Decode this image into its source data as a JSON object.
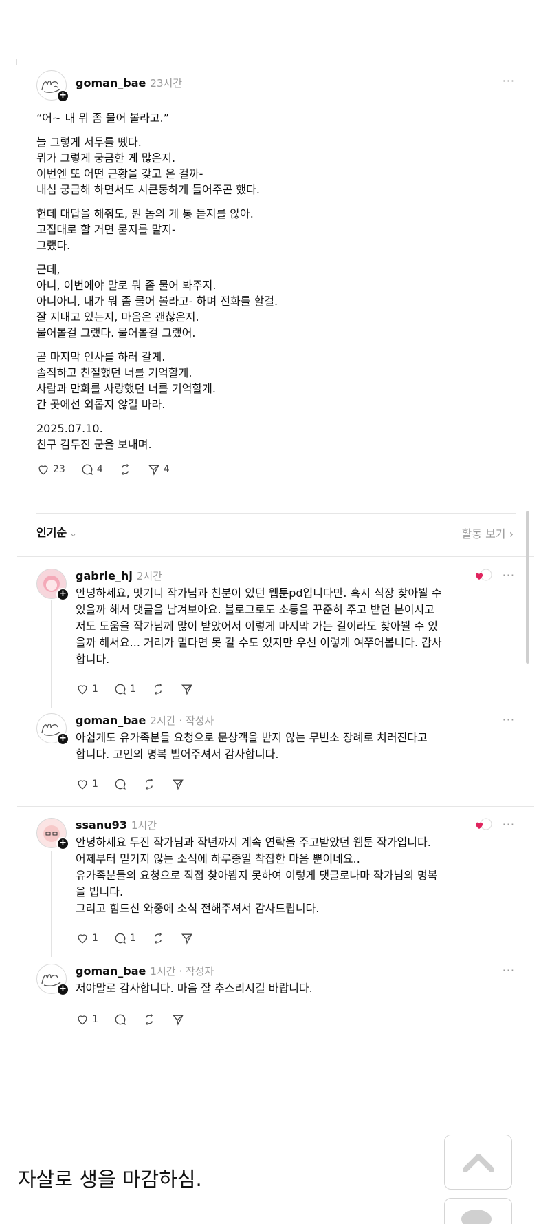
{
  "post": {
    "author": "goman_bae",
    "time": "23시간",
    "more": "···",
    "paragraphs": [
      [
        "“어~ 내 뭐 좀 물어 볼라고.”"
      ],
      [
        "늘 그렇게 서두를 뗐다.",
        "뭐가 그렇게 궁금한 게 많은지.",
        "이번엔 또 어떤 근황을 갖고 온 걸까-",
        "내심 궁금해 하면서도 시큰둥하게 들어주곤 했다."
      ],
      [
        "헌데 대답을 해줘도, 뭔 놈의 게 통 듣지를 않아.",
        "고집대로 할 거면 묻지를 말지-",
        "그랬다."
      ],
      [
        "근데,",
        "아니, 이번에야 말로 뭐 좀 물어 봐주지.",
        "아니아니, 내가 뭐 좀 물어 볼라고- 하며 전화를 할걸.",
        "잘 지내고 있는지, 마음은 괜찮은지.",
        "물어볼걸 그랬다. 물어볼걸 그랬어."
      ],
      [
        "곧 마지막 인사를 하러 갈게.",
        "솔직하고 친절했던 너를 기억할게.",
        "사람과 만화를 사랑했던 너를 기억할게.",
        "간 곳에선 외롭지 않길 바라."
      ],
      [
        "2025.07.10.",
        "친구 김두진 군을 보내며."
      ]
    ],
    "likes": "23",
    "comments": "4",
    "shares": "4"
  },
  "sort": {
    "label": "인기순",
    "chevron": "⌄",
    "activity": "활동 보기 ›"
  },
  "comments": [
    {
      "author": "gabrie_hj",
      "time": "2시간",
      "more": "···",
      "lines": [
        "안녕하세요, 맛기니 작가님과 친분이 있던 웹툰pd입니다만. 혹시 식장 찾아뵐 수",
        "있을까 해서 댓글을 남겨보아요. 블로그로도 소통을 꾸준히 주고 받던 분이시고",
        "저도 도움을 작가님께 많이 받았어서 이렇게 마지막 가는 길이라도 찾아뵐 수 있",
        "을까 해서요... 거리가 멀다면 못 갈 수도 있지만 우선 이렇게 여쭈어봅니다. 감사",
        "합니다."
      ],
      "likes": "1",
      "replies": "1"
    },
    {
      "author": "goman_bae",
      "time": "2시간 · 작성자",
      "more": "···",
      "lines": [
        "아쉽게도 유가족분들 요청으로 문상객을 받지 않는 무빈소 장례로 치러진다고",
        "합니다. 고인의 명복 빌어주셔서 감사합니다."
      ],
      "likes": "1",
      "replies": ""
    },
    {
      "author": "ssanu93",
      "time": "1시간",
      "more": "···",
      "lines": [
        "안녕하세요 두진 작가님과 작년까지 계속 연락을 주고받았던 웹툰 작가입니다.",
        "어제부터 믿기지 않는 소식에 하루종일 착잡한 마음 뿐이네요..",
        "유가족분들의 요청으로 직접 찾아뵙지 못하여 이렇게 댓글로나마 작가님의 명복",
        "을 빕니다.",
        "그리고 힘드신 와중에 소식 전해주셔서 감사드립니다."
      ],
      "likes": "1",
      "replies": "1"
    },
    {
      "author": "goman_bae",
      "time": "1시간 · 작성자",
      "more": "···",
      "lines": [
        "저야말로 감사합니다. 마음 잘 추스리시길 바랍니다."
      ],
      "likes": "1",
      "replies": ""
    }
  ],
  "caption": "자살로 생을 마감하심.",
  "colors": {
    "accent_heart": "#e0245e",
    "muted": "#999999",
    "divider": "#e6e6e6"
  }
}
